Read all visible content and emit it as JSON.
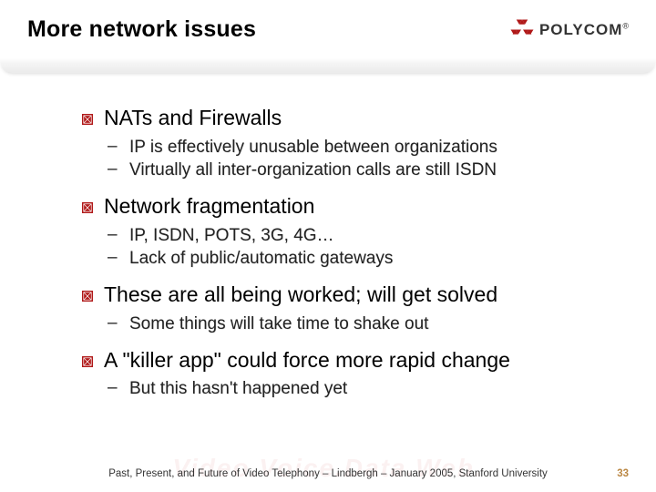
{
  "brand": {
    "name": "POLYCOM",
    "reg": "®"
  },
  "title": "More network issues",
  "watermark": "Video.Voice.Data.Web.",
  "items": [
    {
      "text": "NATs and Firewalls",
      "sub": [
        "IP is effectively unusable between organizations",
        "Virtually all inter-organization calls are still ISDN"
      ]
    },
    {
      "text": "Network fragmentation",
      "sub": [
        "IP, ISDN, POTS, 3G, 4G…",
        "Lack of public/automatic gateways"
      ]
    },
    {
      "text": "These are all being worked; will get solved",
      "sub": [
        "Some things will take time to shake out"
      ]
    },
    {
      "text": "A \"killer app\" could force more rapid change",
      "sub": [
        "But this hasn't happened yet"
      ]
    }
  ],
  "footer": {
    "text": "Past, Present, and Future of Video Telephony – Lindbergh – January 2005, Stanford University",
    "page": "33"
  }
}
